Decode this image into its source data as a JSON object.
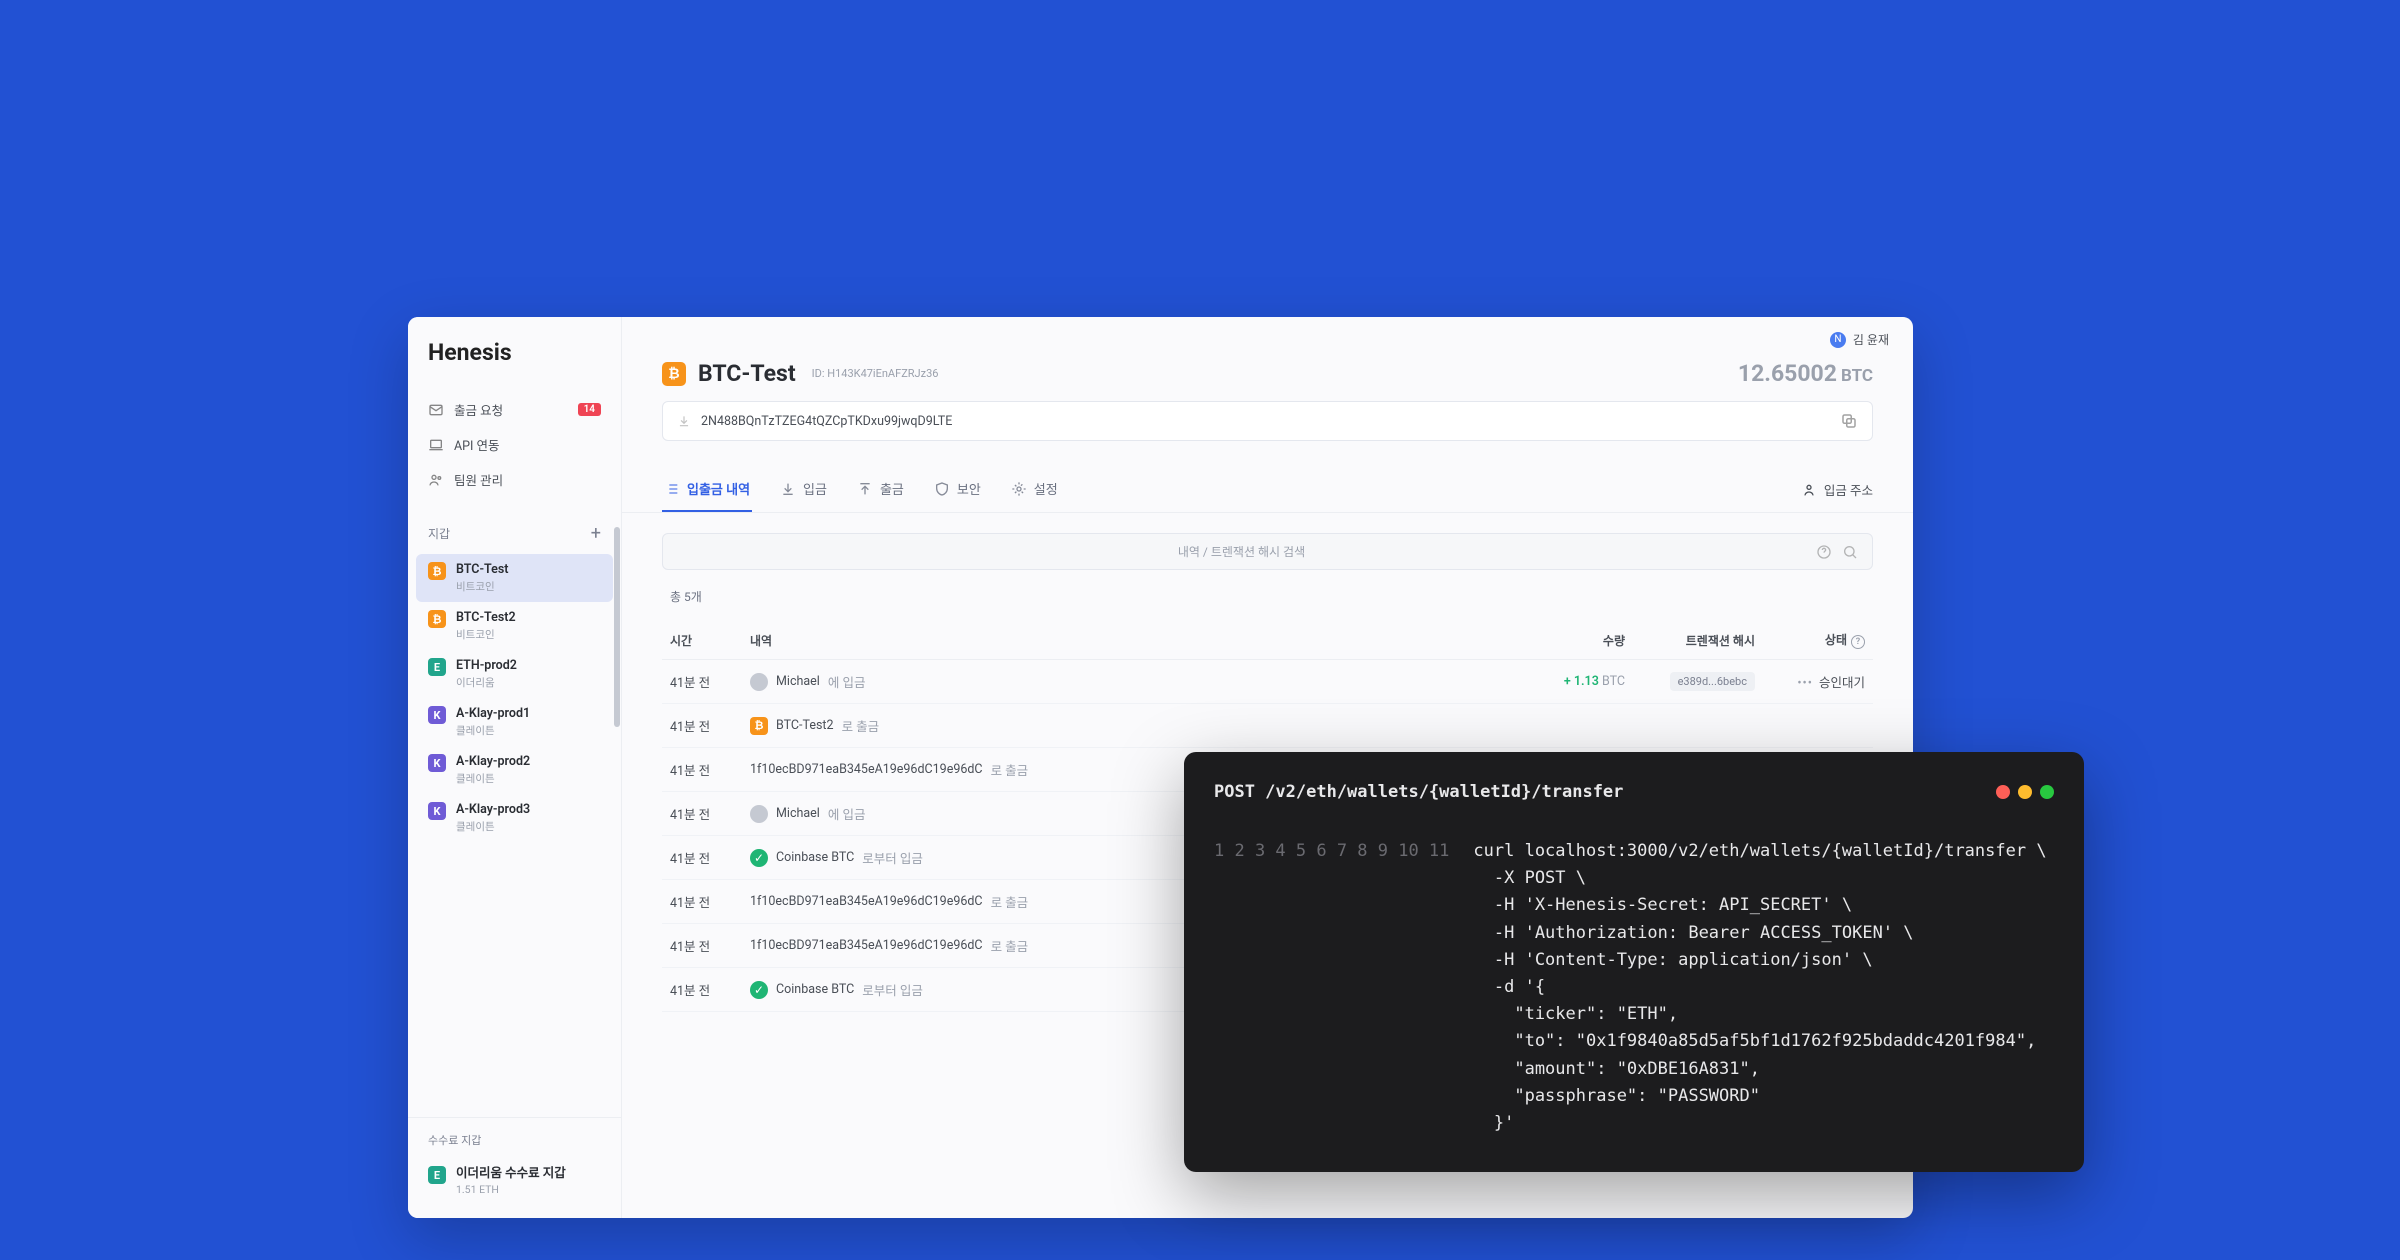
{
  "brand": "Henesis",
  "user": {
    "name": "김 윤재",
    "initial": "N"
  },
  "nav": [
    {
      "label": "출금 요청",
      "badge": "14"
    },
    {
      "label": "API 연동"
    },
    {
      "label": "팀원 관리"
    }
  ],
  "sections": {
    "wallets": "지갑",
    "fee": "수수료 지갑"
  },
  "wallets": [
    {
      "name": "BTC-Test",
      "sub": "비트코인",
      "coin": "btc",
      "active": true
    },
    {
      "name": "BTC-Test2",
      "sub": "비트코인",
      "coin": "btc"
    },
    {
      "name": "ETH-prod2",
      "sub": "이더리움",
      "coin": "eth"
    },
    {
      "name": "A-Klay-prod1",
      "sub": "클레이튼",
      "coin": "klay"
    },
    {
      "name": "A-Klay-prod2",
      "sub": "클레이튼",
      "coin": "klay"
    },
    {
      "name": "A-Klay-prod3",
      "sub": "클레이튼",
      "coin": "klay"
    }
  ],
  "fee_wallet": {
    "name": "이더리움 수수료 지갑",
    "sub": "1.51 ETH"
  },
  "header": {
    "title": "BTC-Test",
    "id_label": "ID: H143K47iEnAFZRJz36",
    "balance": "12.65002",
    "ticker": "BTC",
    "address": "2N488BQnTzTZEG4tQZCpTKDxu99jwqD9LTE"
  },
  "tabs": [
    "입출금 내역",
    "입금",
    "출금",
    "보안",
    "설정"
  ],
  "deposit_addr_label": "입금 주소",
  "search_placeholder": "내역 / 트렌잭션 해시 검색",
  "total": "총 5개",
  "cols": {
    "time": "시간",
    "detail": "내역",
    "amount": "수량",
    "hash": "트렌잭션 해시",
    "status": "상태"
  },
  "rows": [
    {
      "time": "41분 전",
      "icon": "avatar",
      "who": "Michael",
      "suf": "에 입금",
      "amt": "+ 1.13",
      "tick": "BTC",
      "hash": "e389d...6bebc",
      "status": "승인대기"
    },
    {
      "time": "41분 전",
      "icon": "btc",
      "who": "BTC-Test2",
      "suf": "로 출금"
    },
    {
      "time": "41분 전",
      "icon": "",
      "who": "1f10ecBD971eaB345eA19e96dC19e96dC",
      "suf": "로 출금"
    },
    {
      "time": "41분 전",
      "icon": "avatar",
      "who": "Michael",
      "suf": "에 입금"
    },
    {
      "time": "41분 전",
      "icon": "check",
      "who": "Coinbase BTC",
      "suf": "로부터 입금"
    },
    {
      "time": "41분 전",
      "icon": "",
      "who": "1f10ecBD971eaB345eA19e96dC19e96dC",
      "suf": "로 출금"
    },
    {
      "time": "41분 전",
      "icon": "",
      "who": "1f10ecBD971eaB345eA19e96dC19e96dC",
      "suf": "로 출금"
    },
    {
      "time": "41분 전",
      "icon": "check",
      "who": "Coinbase BTC",
      "suf": "로부터 입금"
    }
  ],
  "terminal": {
    "title": "POST /v2/eth/wallets/{walletId}/transfer",
    "lines": [
      "curl localhost:3000/v2/eth/wallets/{walletId}/transfer \\",
      "  -X POST \\",
      "  -H 'X-Henesis-Secret: API_SECRET' \\",
      "  -H 'Authorization: Bearer ACCESS_TOKEN' \\",
      "  -H 'Content-Type: application/json' \\",
      "  -d '{",
      "    \"ticker\": \"ETH\",",
      "    \"to\": \"0x1f9840a85d5af5bf1d1762f925bdaddc4201f984\",",
      "    \"amount\": \"0xDBE16A831\",",
      "    \"passphrase\": \"PASSWORD\"",
      "  }'"
    ]
  }
}
